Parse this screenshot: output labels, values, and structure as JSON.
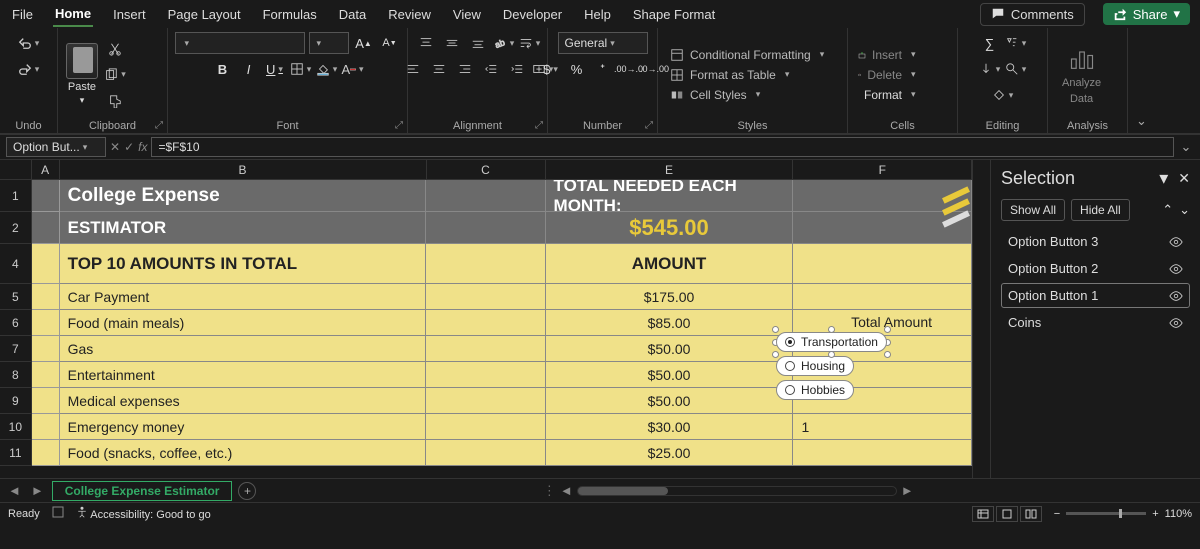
{
  "menu": {
    "file": "File",
    "home": "Home",
    "insert": "Insert",
    "pageLayout": "Page Layout",
    "formulas": "Formulas",
    "data": "Data",
    "review": "Review",
    "view": "View",
    "developer": "Developer",
    "help": "Help",
    "shapeFormat": "Shape Format",
    "comments": "Comments",
    "share": "Share"
  },
  "ribbon": {
    "undo": "Undo",
    "clipboard": "Clipboard",
    "paste": "Paste",
    "font": "Font",
    "alignment": "Alignment",
    "number": "Number",
    "styles": "Styles",
    "cells": "Cells",
    "editing": "Editing",
    "analysis": "Analysis",
    "numberFormat": "General",
    "condFmt": "Conditional Formatting",
    "fmtTable": "Format as Table",
    "cellStyles": "Cell Styles",
    "insert": "Insert",
    "delete": "Delete",
    "format": "Format",
    "analyze1": "Analyze",
    "analyze2": "Data",
    "bold": "B",
    "italic": "I",
    "underline": "U"
  },
  "formulaBar": {
    "nameBox": "Option But...",
    "fx": "fx",
    "formula": "=$F$10"
  },
  "columns": {
    "A": "A",
    "B": "B",
    "C": "C",
    "E": "E",
    "F": "F"
  },
  "rows": {
    "r1": "1",
    "r2": "2",
    "r4": "4",
    "r5": "5",
    "r6": "6",
    "r7": "7",
    "r8": "8",
    "r9": "9",
    "r10": "10",
    "r11": "11"
  },
  "sheet": {
    "title1": "College Expense",
    "title2": "ESTIMATOR",
    "totalLabel": "TOTAL NEEDED EACH MONTH:",
    "totalValue": "$545.00",
    "topHeader": "TOP 10 AMOUNTS IN TOTAL",
    "amountHeader": "AMOUNT",
    "optTotalLabel": "Total Amount",
    "opt1": "Transportation",
    "opt2": "Housing",
    "opt3": "Hobbies",
    "fval": "1",
    "items": [
      {
        "label": "Car Payment",
        "amount": "$175.00"
      },
      {
        "label": "Food (main meals)",
        "amount": "$85.00"
      },
      {
        "label": "Gas",
        "amount": "$50.00"
      },
      {
        "label": "Entertainment",
        "amount": "$50.00"
      },
      {
        "label": "Medical expenses",
        "amount": "$50.00"
      },
      {
        "label": "Emergency money",
        "amount": "$30.00"
      },
      {
        "label": "Food (snacks, coffee, etc.)",
        "amount": "$25.00"
      }
    ]
  },
  "selectionPane": {
    "title": "Selection",
    "showAll": "Show All",
    "hideAll": "Hide All",
    "items": [
      {
        "name": "Option Button 3"
      },
      {
        "name": "Option Button 2"
      },
      {
        "name": "Option Button 1"
      },
      {
        "name": "Coins"
      }
    ]
  },
  "sheetTab": "College Expense Estimator",
  "status": {
    "ready": "Ready",
    "access": "Accessibility: Good to go",
    "zoom": "110%"
  }
}
